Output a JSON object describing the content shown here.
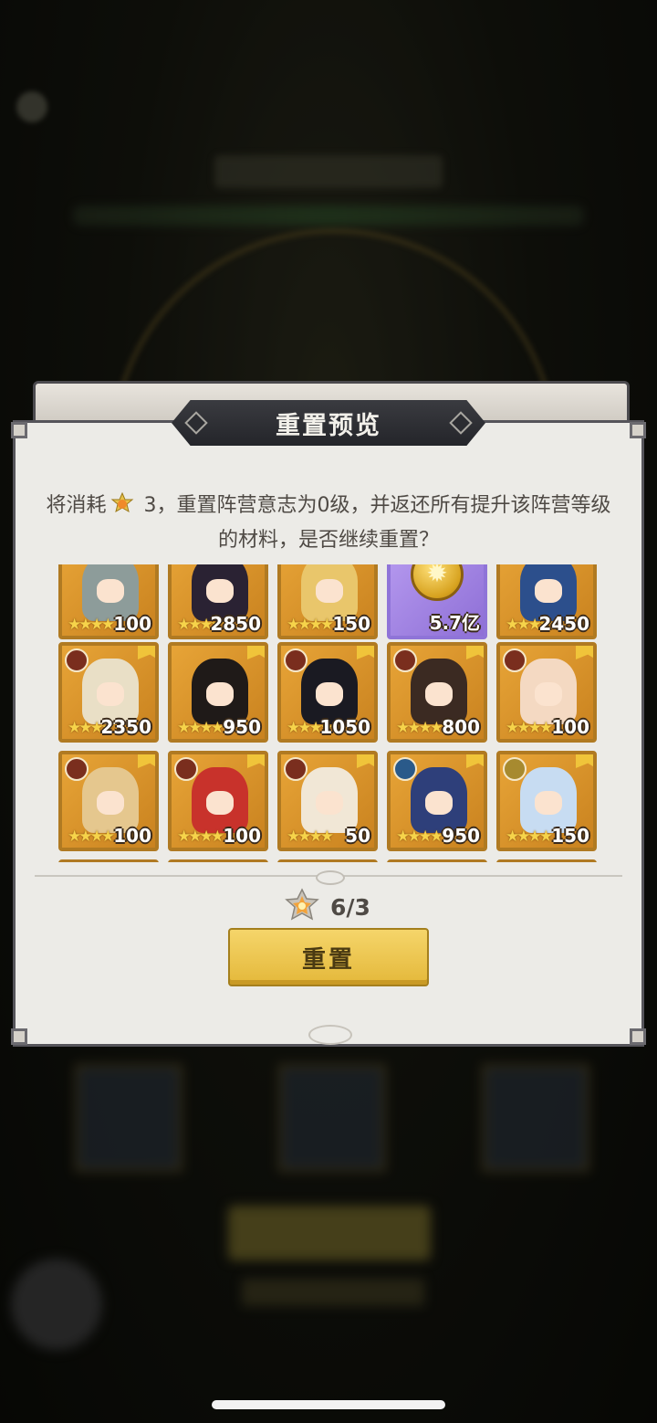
{
  "dialog": {
    "title": "重置预览",
    "message_before": "将消耗",
    "message_after": " 3，重置阵营意志为0级，并返还所有提升该阵营等级的材料，是否继续重置？",
    "cost_icon": "faction-will-medal-icon",
    "cost_counter": "6/3",
    "reset_label": "重置"
  },
  "grid": {
    "rows": [
      [
        {
          "count": "100",
          "faction": "none",
          "hair": "#8d9c9a"
        },
        {
          "count": "2850",
          "faction": "none",
          "hair": "#2a2233"
        },
        {
          "count": "150",
          "faction": "none",
          "hair": "#e9c66b"
        },
        {
          "count": "5.7亿",
          "type": "currency",
          "icon": "gold-coin-icon"
        },
        {
          "count": "2450",
          "faction": "none",
          "hair": "#2c4f8c"
        }
      ],
      [
        {
          "count": "2350",
          "faction": "beast",
          "hair": "#e9dfc6"
        },
        {
          "count": "950",
          "faction": "none",
          "hair": "#1f1a18"
        },
        {
          "count": "1050",
          "faction": "beast",
          "hair": "#1a1a22"
        },
        {
          "count": "800",
          "faction": "beast",
          "hair": "#3b2a22"
        },
        {
          "count": "100",
          "faction": "beast",
          "hair": "#f4d9c2"
        }
      ],
      [
        {
          "count": "100",
          "faction": "beast",
          "hair": "#e5c78e"
        },
        {
          "count": "100",
          "faction": "beast",
          "hair": "#c8322b"
        },
        {
          "count": "50",
          "faction": "beast",
          "hair": "#f1e7d6"
        },
        {
          "count": "950",
          "faction": "water",
          "hair": "#2e3f7a"
        },
        {
          "count": "150",
          "faction": "light",
          "hair": "#c7dcf2"
        }
      ]
    ],
    "stars_per_card": 4
  }
}
